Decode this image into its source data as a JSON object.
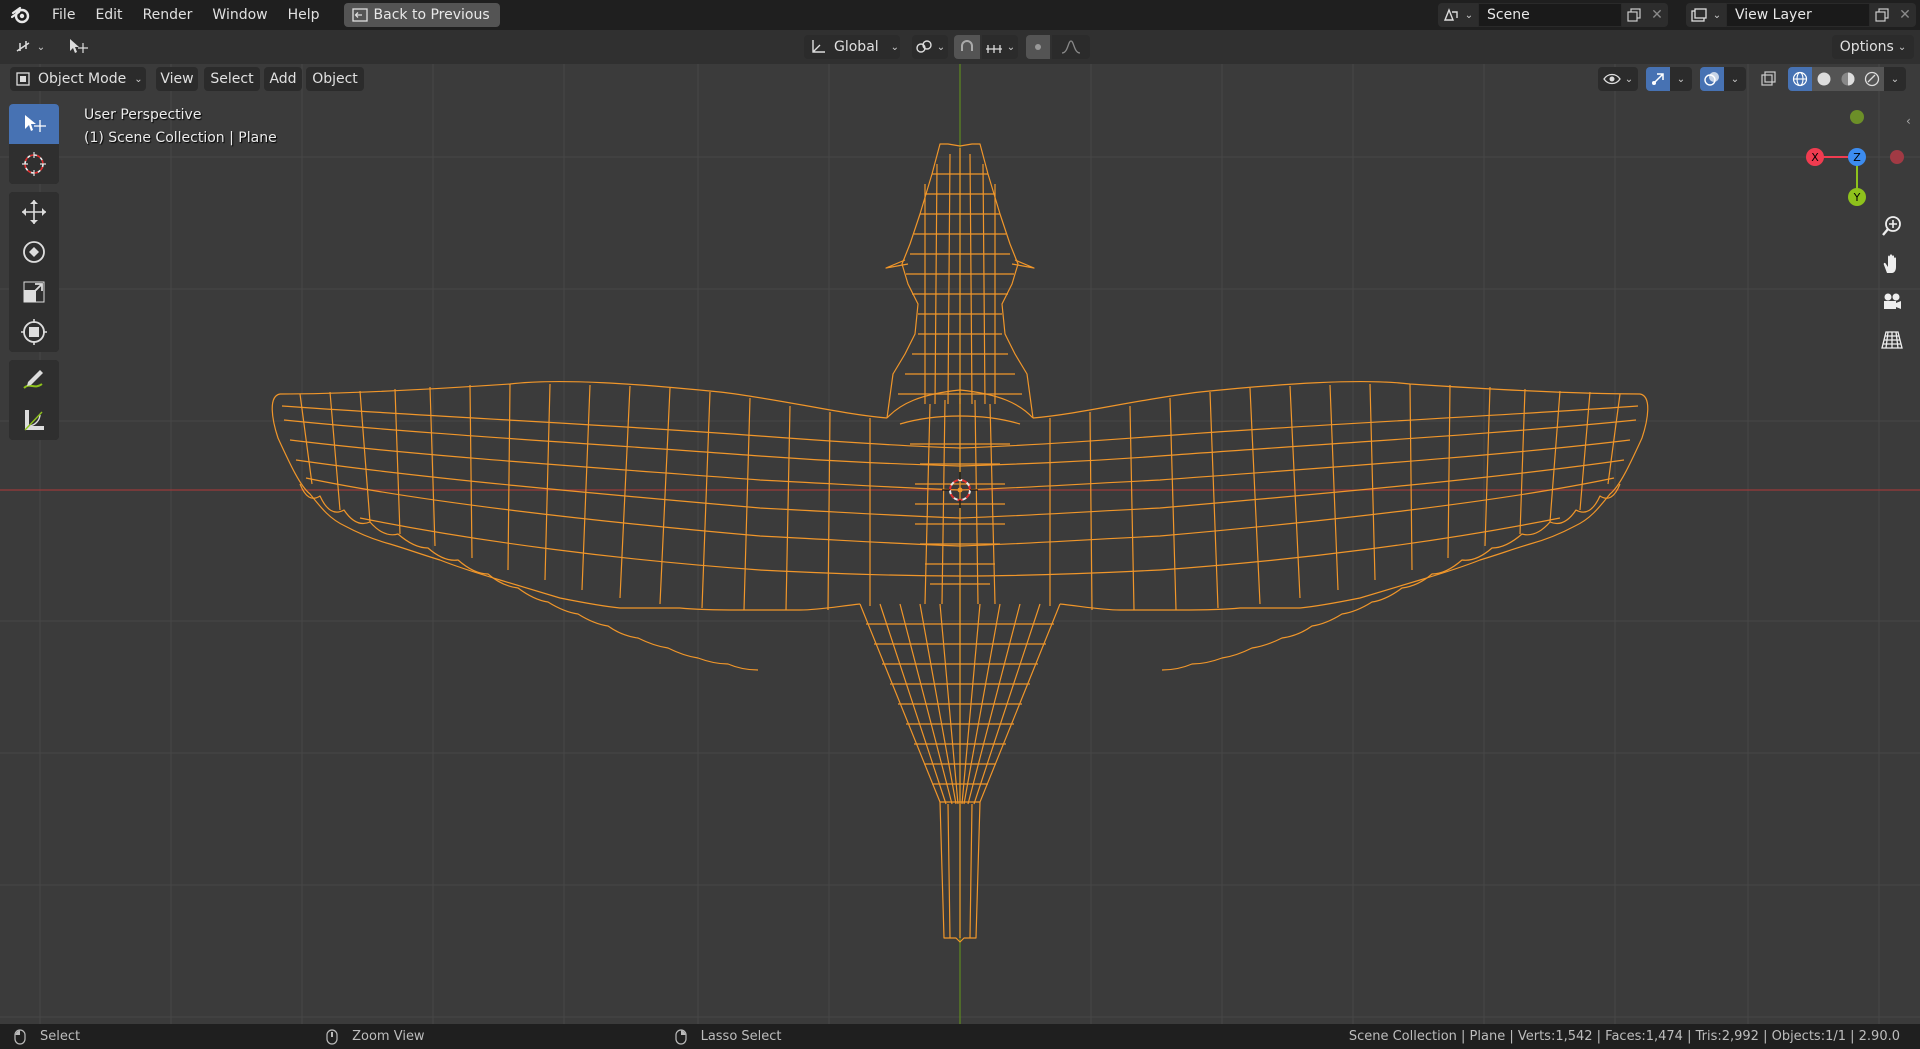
{
  "menu": {
    "items": [
      "File",
      "Edit",
      "Render",
      "Window",
      "Help"
    ],
    "back_label": "Back to Previous"
  },
  "scene": {
    "label": "Scene"
  },
  "view_layer": {
    "label": "View Layer"
  },
  "tool_header": {
    "transform_orientation": "Global",
    "options_label": "Options"
  },
  "viewport_header": {
    "mode": "Object Mode",
    "menus": [
      "View",
      "Select",
      "Add",
      "Object"
    ]
  },
  "viewport": {
    "view_name": "User Perspective",
    "collection_info": "(1) Scene Collection | Plane"
  },
  "gizmo": {
    "x": "X",
    "y": "Y",
    "z": "Z"
  },
  "status": {
    "select": "Select",
    "zoom": "Zoom View",
    "lasso": "Lasso Select",
    "stats": "Scene Collection | Plane | Verts:1,542 | Faces:1,474 | Tris:2,992 | Objects:1/1 | 2.90.0"
  },
  "colors": {
    "accent": "#4772b3",
    "wire_selected": "#f0962a",
    "axis_x": "#f03c50",
    "axis_y": "#8ec21c",
    "axis_z": "#3c8cf0"
  }
}
